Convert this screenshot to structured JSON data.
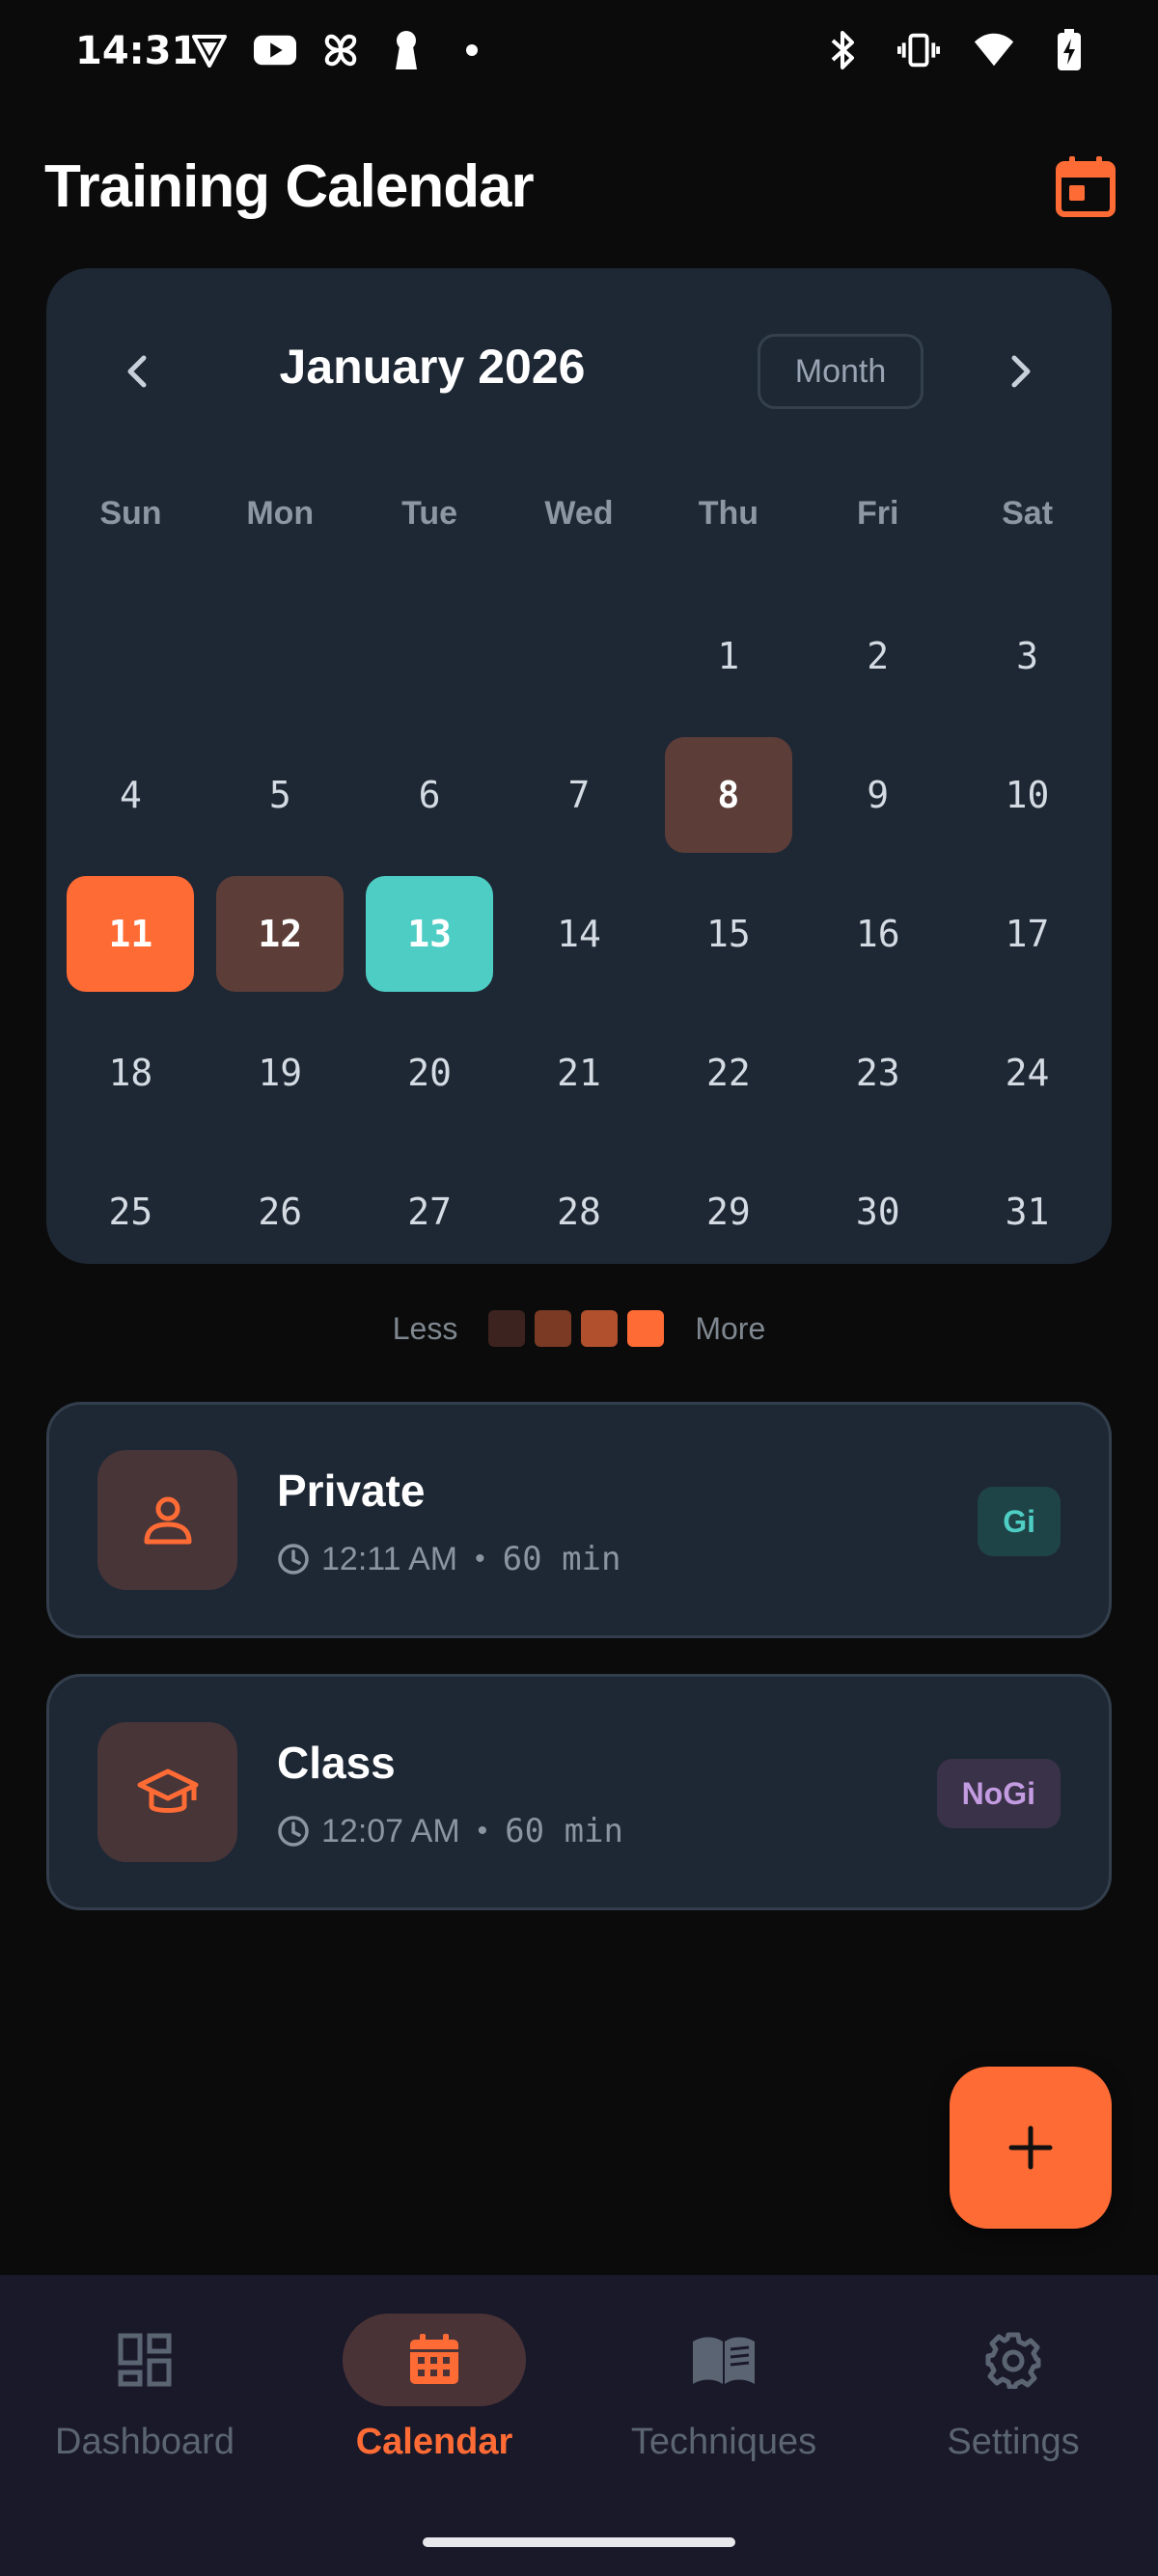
{
  "status_bar": {
    "time": "14:31",
    "left_icons": [
      "vpn-triangle-icon",
      "youtube-icon",
      "pinwheel-icon",
      "keyhole-icon",
      "dot-icon"
    ],
    "right_icons": [
      "bluetooth-icon",
      "vibrate-icon",
      "wifi-icon",
      "battery-charging-icon"
    ]
  },
  "header": {
    "title": "Training Calendar",
    "icon": "calendar-today-icon"
  },
  "calendar": {
    "month_label": "January 2026",
    "view_toggle": "Month",
    "weekdays": [
      "Sun",
      "Mon",
      "Tue",
      "Wed",
      "Thu",
      "Fri",
      "Sat"
    ],
    "leading_blank_days": 4,
    "days": [
      "1",
      "2",
      "3",
      "4",
      "5",
      "6",
      "7",
      "8",
      "9",
      "10",
      "11",
      "12",
      "13",
      "14",
      "15",
      "16",
      "17",
      "18",
      "19",
      "20",
      "21",
      "22",
      "23",
      "24",
      "25",
      "26",
      "27",
      "28",
      "29",
      "30",
      "31"
    ],
    "training_days": [
      "8",
      "12"
    ],
    "selected_day": "11",
    "today": "13"
  },
  "legend": {
    "less_label": "Less",
    "more_label": "More",
    "swatch_colors": [
      "#3d231f",
      "#7a3a24",
      "#b0502d",
      "#ff6b35"
    ]
  },
  "sessions": [
    {
      "name": "Private",
      "icon": "person-icon",
      "time": "12:11 AM",
      "separator": "•",
      "duration": "60 min",
      "tag": "Gi"
    },
    {
      "name": "Class",
      "icon": "graduation-cap-icon",
      "time": "12:07 AM",
      "separator": "•",
      "duration": "60 min",
      "tag": "NoGi"
    }
  ],
  "fab": {
    "icon": "plus-icon"
  },
  "bottom_nav": {
    "items": [
      {
        "label": "Dashboard",
        "icon": "dashboard-icon",
        "active": false
      },
      {
        "label": "Calendar",
        "icon": "calendar-icon",
        "active": true
      },
      {
        "label": "Techniques",
        "icon": "book-icon",
        "active": false
      },
      {
        "label": "Settings",
        "icon": "gear-icon",
        "active": false
      }
    ]
  },
  "colors": {
    "accent": "#ff6b35",
    "today": "#4ecdc4",
    "training_day": "#5c3d38",
    "card_background": "#1e2834",
    "page_background": "#0b0b0c"
  }
}
